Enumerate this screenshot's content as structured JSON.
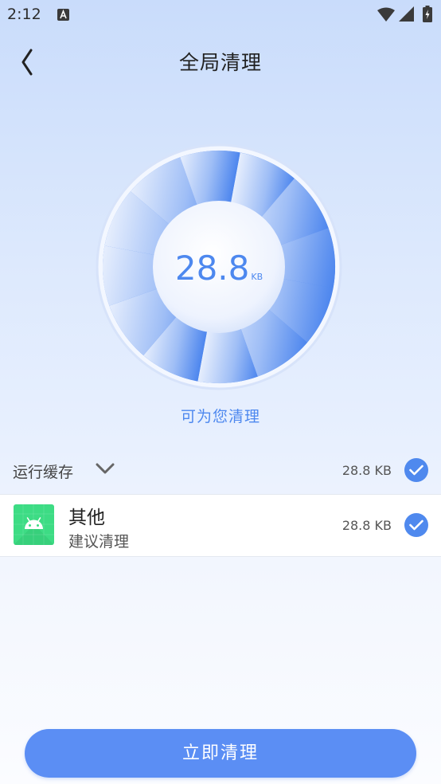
{
  "status": {
    "time": "2:12"
  },
  "header": {
    "title": "全局清理"
  },
  "gauge": {
    "value": "28.8",
    "unit": "KB",
    "hint": "可为您清理"
  },
  "category": {
    "label": "运行缓存",
    "size": "28.8 KB"
  },
  "items": [
    {
      "name": "其他",
      "subtitle": "建议清理",
      "size": "28.8 KB"
    }
  ],
  "action": {
    "label": "立即清理"
  },
  "colors": {
    "accent": "#4f89ee",
    "button": "#5b8ef4",
    "app_icon": "#3ddc84"
  }
}
